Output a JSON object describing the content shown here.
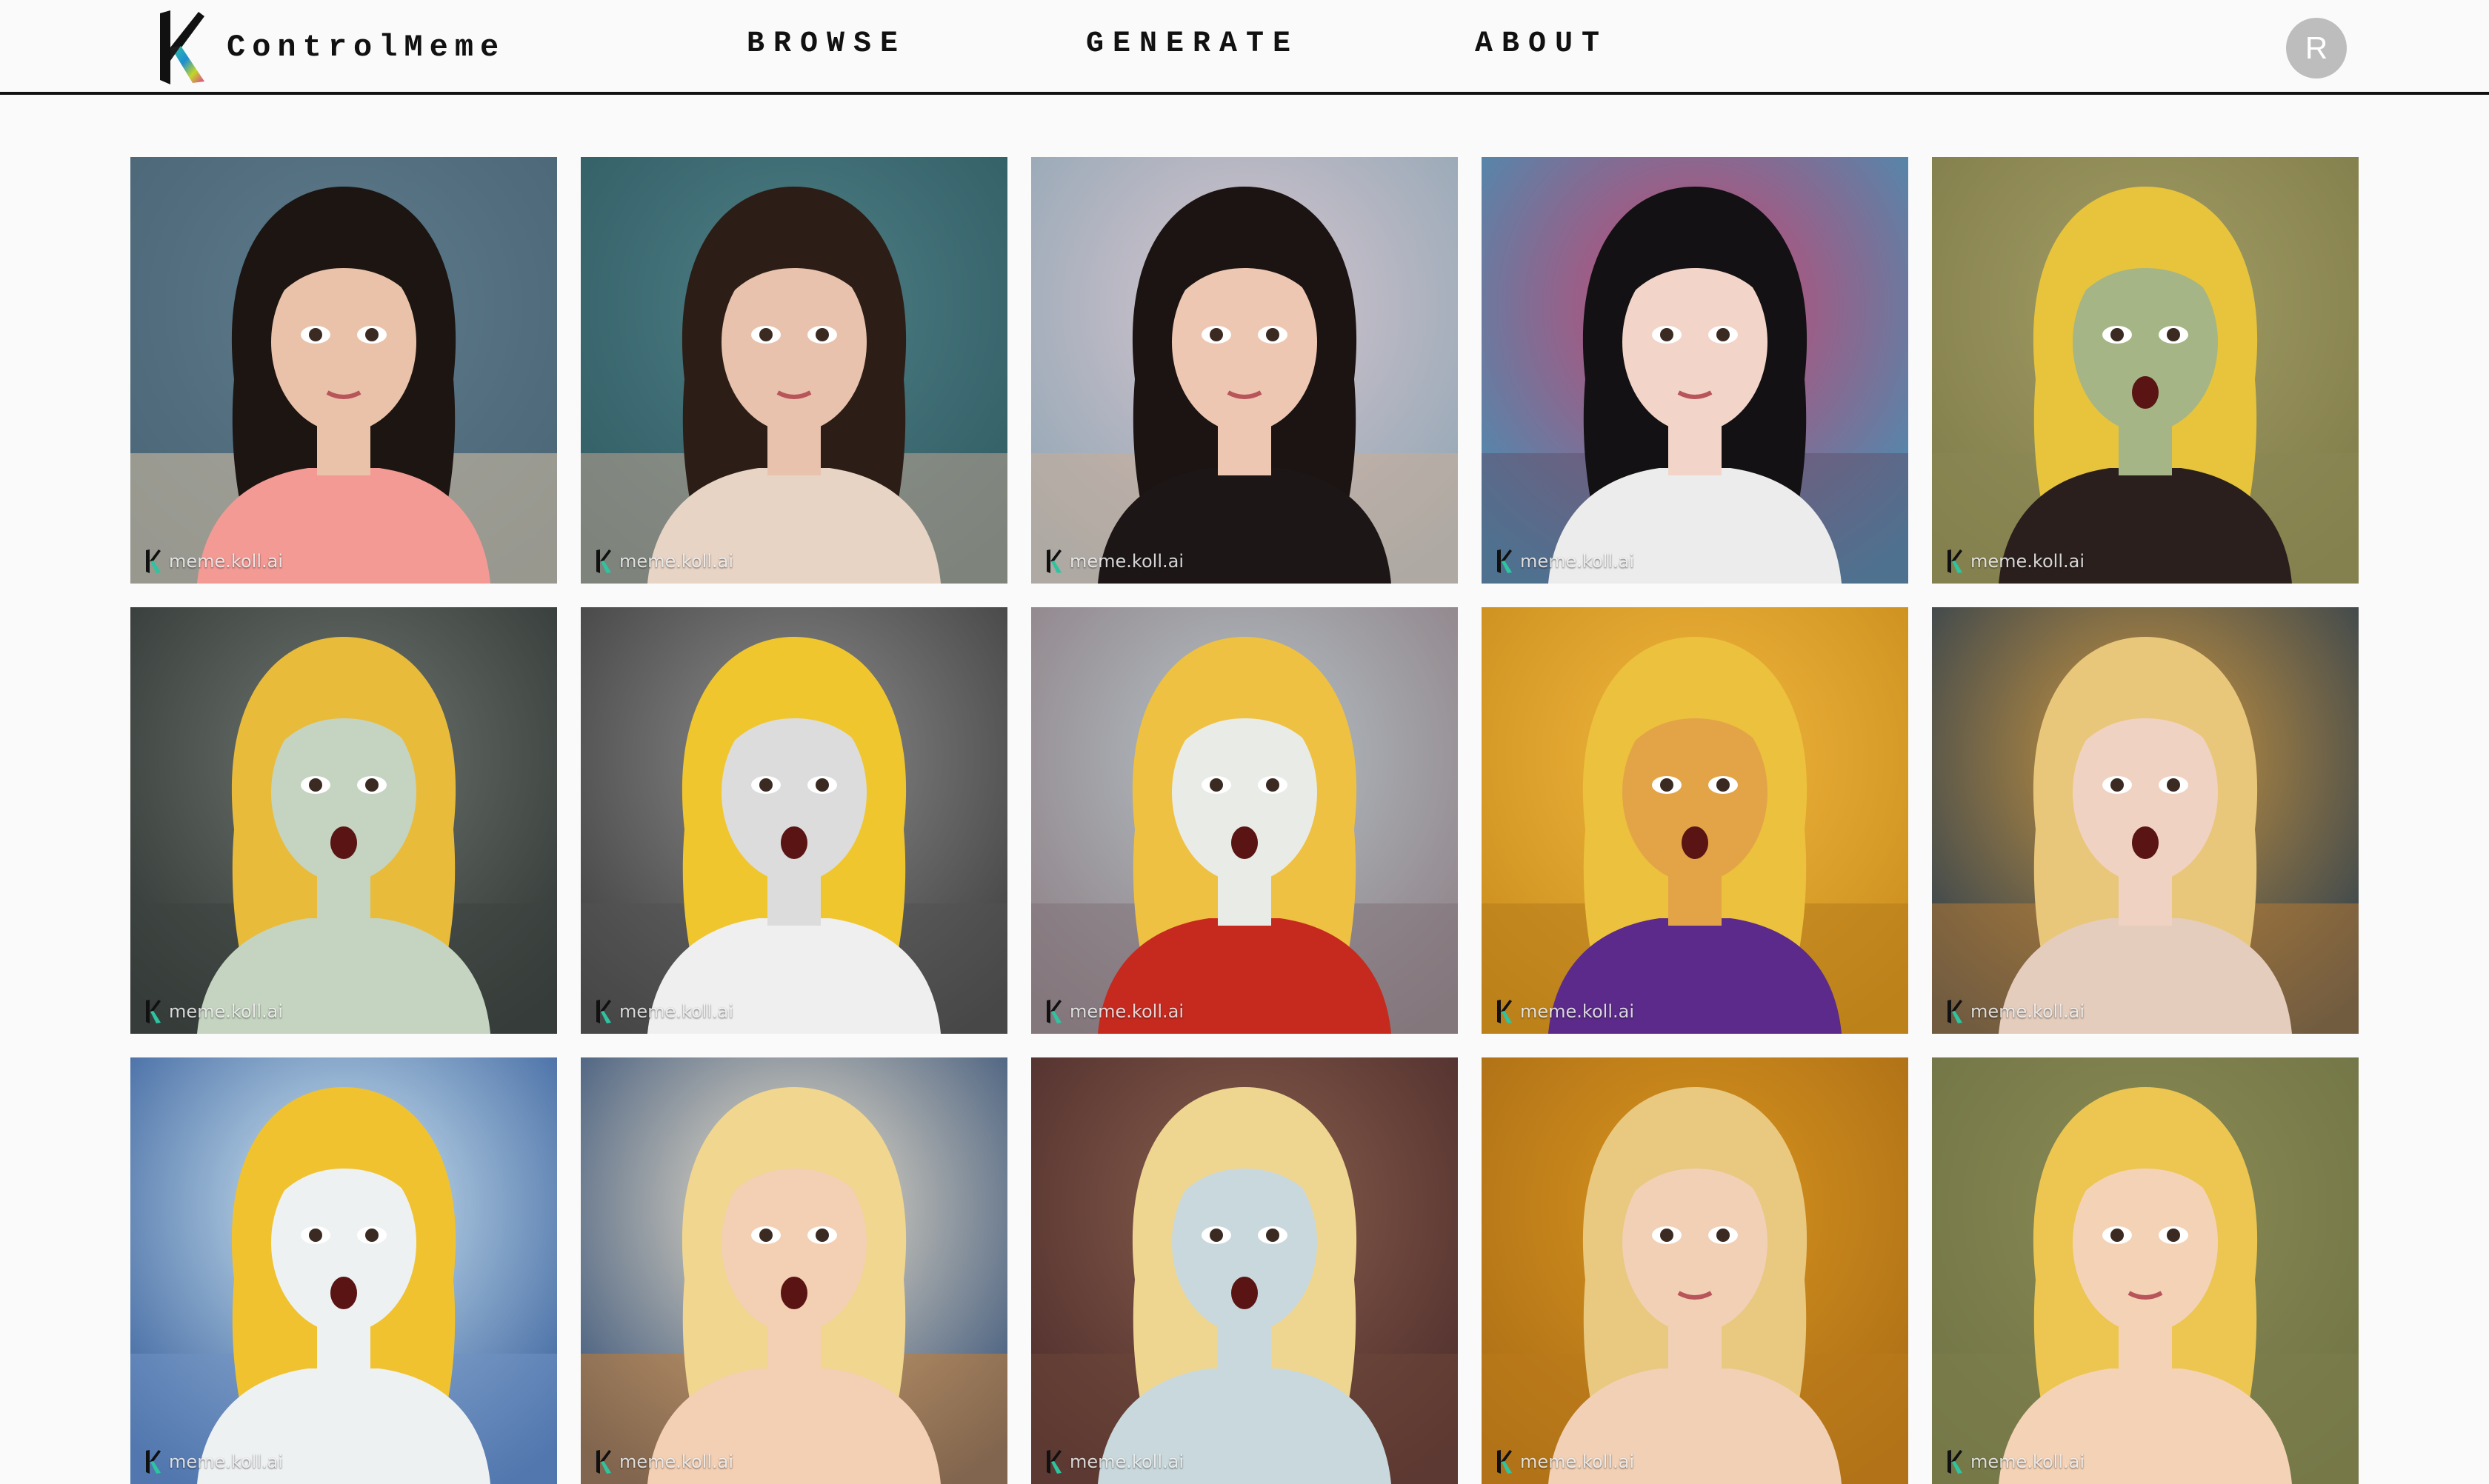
{
  "app": {
    "name": "ControlMeme"
  },
  "nav": {
    "links": [
      {
        "label": "BROWSE"
      },
      {
        "label": "GENERATE"
      },
      {
        "label": "ABOUT"
      }
    ],
    "avatar_initial": "R"
  },
  "gallery": {
    "watermark": "meme.koll.ai",
    "items": [
      {
        "bg1": "#5d7b8c",
        "bg2": "#4a6474",
        "lower": "#d8c3a6",
        "hair": "#1c1512",
        "skin": "#e9c2a9",
        "shirt": "#f39a94",
        "mouth_open": false
      },
      {
        "bg1": "#4f7f86",
        "bg2": "#2f5a62",
        "lower": "#bfa592",
        "hair": "#2c1e16",
        "skin": "#e8c2ad",
        "shirt": "#e8d4c5",
        "mouth_open": false
      },
      {
        "bg1": "#d7c6cf",
        "bg2": "#8ea4b3",
        "lower": "#c9ad95",
        "hair": "#1b1412",
        "skin": "#eec7b2",
        "shirt": "#1d1617",
        "mouth_open": false
      },
      {
        "bg1": "#d0406c",
        "bg2": "#3b95b8",
        "lower": "#5e5470",
        "hair": "#131113",
        "skin": "#f2d5c8",
        "shirt": "#ececec",
        "mouth_open": false
      },
      {
        "bg1": "#a39e66",
        "bg2": "#7e7a48",
        "lower": "#8b8654",
        "hair": "#e7c43c",
        "skin": "#a5b585",
        "shirt": "#2a1f1d",
        "mouth_open": true
      },
      {
        "bg1": "#6f7671",
        "bg2": "#2e3431",
        "lower": "#3c4440",
        "hair": "#e9bb3a",
        "skin": "#c5d4c0",
        "shirt": "#c5d4c0",
        "mouth_open": true
      },
      {
        "bg1": "#8d8d8d",
        "bg2": "#3b3b3b",
        "lower": "#525252",
        "hair": "#f0c62f",
        "skin": "#dcdcdc",
        "shirt": "#efefef",
        "mouth_open": true
      },
      {
        "bg1": "#b6c3c7",
        "bg2": "#8b7c82",
        "lower": "#7f7379",
        "hair": "#efc142",
        "skin": "#e9ebe6",
        "shirt": "#c62a1f",
        "mouth_open": true
      },
      {
        "bg1": "#f2b83e",
        "bg2": "#c78a1b",
        "lower": "#b47a1a",
        "hair": "#ecc13d",
        "skin": "#e3a448",
        "shirt": "#5b2a8a",
        "mouth_open": true
      },
      {
        "bg1": "#d29a3f",
        "bg2": "#23394f",
        "lower": "#b57a34",
        "hair": "#e9c77a",
        "skin": "#f0d2c2",
        "shirt": "#e4cdbd",
        "mouth_open": true
      },
      {
        "bg1": "#d6edf7",
        "bg2": "#2f5897",
        "lower": "#6f92c2",
        "hair": "#f0c230",
        "skin": "#eef1f2",
        "shirt": "#eef1f2",
        "mouth_open": true
      },
      {
        "bg1": "#f3e7cf",
        "bg2": "#2d4a73",
        "lower": "#c77b2f",
        "hair": "#f1d68f",
        "skin": "#f3cfb3",
        "shirt": "#f3cfb3",
        "mouth_open": true
      },
      {
        "bg1": "#8a5f4d",
        "bg2": "#4a2a2a",
        "lower": "#6b4638",
        "hair": "#efd690",
        "skin": "#c9d8dc",
        "shirt": "#c9d8dc",
        "mouth_open": true
      },
      {
        "bg1": "#d9951e",
        "bg2": "#a86b16",
        "lower": "#b97a1b",
        "hair": "#e9c880",
        "skin": "#f1d0b5",
        "shirt": "#f1d0b5",
        "mouth_open": false
      },
      {
        "bg1": "#8a8b55",
        "bg2": "#6f7244",
        "lower": "#7c7d4c",
        "hair": "#ecc650",
        "skin": "#f4d2b6",
        "shirt": "#f4d2b6",
        "mouth_open": false
      }
    ]
  }
}
